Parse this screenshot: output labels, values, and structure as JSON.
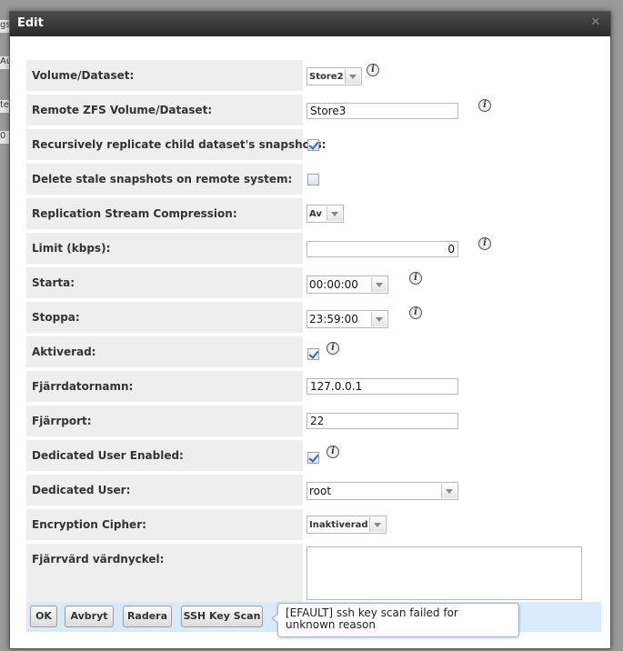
{
  "background": {
    "fragments": [
      "gs",
      "Aut",
      "te",
      "0"
    ]
  },
  "dialog": {
    "title": "Edit",
    "close_icon": "close-icon"
  },
  "form": {
    "volume_dataset": {
      "label": "Volume/Dataset:",
      "value": "Store2"
    },
    "remote_dataset": {
      "label": "Remote ZFS Volume/Dataset:",
      "value": "Store3"
    },
    "recursive": {
      "label": "Recursively replicate child dataset's snapshots:",
      "checked": true
    },
    "delete_stale": {
      "label": "Delete stale snapshots on remote system:",
      "checked": false
    },
    "compression": {
      "label": "Replication Stream Compression:",
      "value": "Av"
    },
    "limit": {
      "label": "Limit (kbps):",
      "value": "0"
    },
    "start": {
      "label": "Starta:",
      "value": "00:00:00"
    },
    "stop": {
      "label": "Stoppa:",
      "value": "23:59:00"
    },
    "enabled": {
      "label": "Aktiverad:",
      "checked": true
    },
    "remote_host": {
      "label": "Fjärrdatornamn:",
      "value": "127.0.0.1"
    },
    "remote_port": {
      "label": "Fjärrport:",
      "value": "22"
    },
    "dedicated_enabled": {
      "label": "Dedicated User Enabled:",
      "checked": true
    },
    "dedicated_user": {
      "label": "Dedicated User:",
      "value": "root"
    },
    "cipher": {
      "label": "Encryption Cipher:",
      "value": "Inaktiverad"
    },
    "host_key": {
      "label": "Fjärrvärd värdnyckel:",
      "value": ""
    }
  },
  "buttons": {
    "ok": "OK",
    "cancel": "Avbryt",
    "delete": "Radera",
    "ssh_scan": "SSH Key Scan"
  },
  "tooltip": {
    "message": "[EFAULT] ssh key scan failed for unknown reason"
  },
  "icons": {
    "info": "info-icon",
    "dropdown": "chevron-down-icon",
    "close": "close-icon"
  },
  "colors": {
    "titlebar": "#2b2b2b",
    "label_bg": "#eeeeee",
    "buttonbar_bg": "#d9eafa",
    "tooltip_border": "#9ab8d6"
  }
}
